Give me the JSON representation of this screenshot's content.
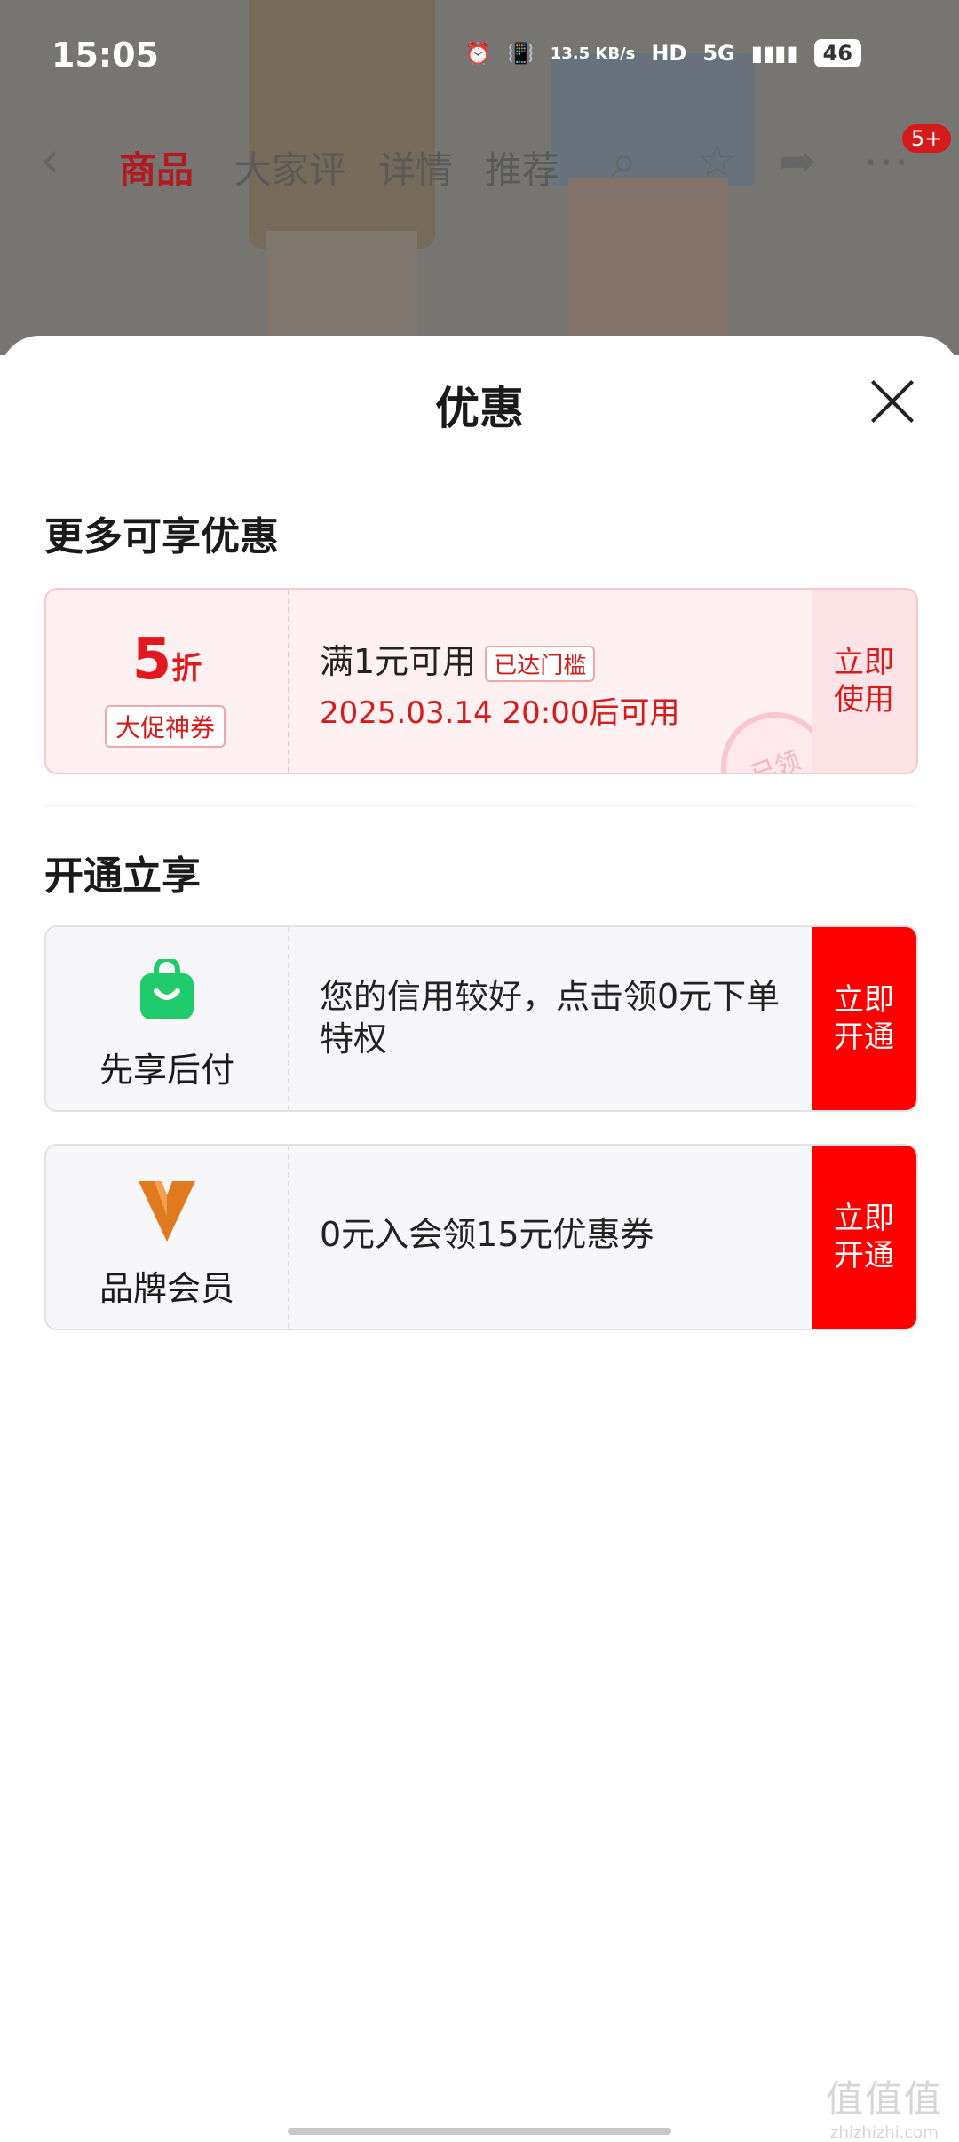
{
  "status_bar": {
    "time": "15:05",
    "net_speed": "13.5 KB/s",
    "hd": "HD",
    "network": "5G",
    "battery": "46"
  },
  "background_nav": {
    "tabs": [
      "商品",
      "大家评",
      "详情",
      "推荐"
    ],
    "active_tab": "商品",
    "badge": "5+"
  },
  "sheet": {
    "title": "优惠",
    "section1_title": "更多可享优惠",
    "coupon": {
      "discount_value": "5",
      "discount_unit": "折",
      "tag": "大促神券",
      "condition": "满1元可用",
      "reached_badge": "已达门槛",
      "valid_time": "2025.03.14 20:00后可用",
      "stamp": "已领",
      "button": "立即使用"
    },
    "section2_title": "开通立享",
    "services": [
      {
        "icon": "shopping-bag-icon",
        "label": "先享后付",
        "desc": "您的信用较好，点击领0元下单特权",
        "button": "立即开通",
        "icon_color": "#1fcb6b"
      },
      {
        "icon": "brand-v-logo-icon",
        "label": "品牌会员",
        "desc": "0元入会领15元优惠券",
        "button": "立即开通",
        "icon_color": "#e07a1f"
      }
    ]
  },
  "watermark": {
    "main": "值值值",
    "sub": "zhizhizhi.com"
  },
  "colors": {
    "accent_red": "#ff0000",
    "coupon_red": "#e1191f"
  }
}
